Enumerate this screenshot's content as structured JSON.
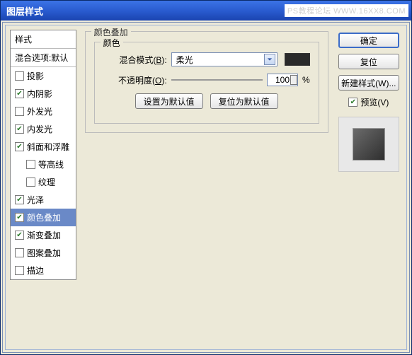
{
  "window": {
    "title": "图层样式"
  },
  "watermark": "PS教程论坛  WWW.16XX8.COM",
  "sidebar": {
    "header": "样式",
    "sub": "混合选项:默认",
    "items": [
      {
        "label": "投影",
        "checked": false,
        "indent": false,
        "selected": false
      },
      {
        "label": "内阴影",
        "checked": true,
        "indent": false,
        "selected": false
      },
      {
        "label": "外发光",
        "checked": false,
        "indent": false,
        "selected": false
      },
      {
        "label": "内发光",
        "checked": true,
        "indent": false,
        "selected": false
      },
      {
        "label": "斜面和浮雕",
        "checked": true,
        "indent": false,
        "selected": false
      },
      {
        "label": "等高线",
        "checked": false,
        "indent": true,
        "selected": false
      },
      {
        "label": "纹理",
        "checked": false,
        "indent": true,
        "selected": false
      },
      {
        "label": "光泽",
        "checked": true,
        "indent": false,
        "selected": false
      },
      {
        "label": "颜色叠加",
        "checked": true,
        "indent": false,
        "selected": true
      },
      {
        "label": "渐变叠加",
        "checked": true,
        "indent": false,
        "selected": false
      },
      {
        "label": "图案叠加",
        "checked": false,
        "indent": false,
        "selected": false
      },
      {
        "label": "描边",
        "checked": false,
        "indent": false,
        "selected": false
      }
    ]
  },
  "main": {
    "title": "颜色叠加",
    "subtitle": "颜色",
    "blend_label_prefix": "混合模式(",
    "blend_label_key": "B",
    "blend_label_suffix": "):",
    "blend_value": "柔光",
    "swatch_color": "#2a2a2a",
    "opacity_label_prefix": "不透明度(",
    "opacity_label_key": "O",
    "opacity_label_suffix": "):",
    "opacity_value": "100",
    "opacity_unit": "%",
    "btn_default": "设置为默认值",
    "btn_reset": "复位为默认值"
  },
  "right": {
    "ok": "确定",
    "reset": "复位",
    "newstyle": "新建样式(W)...",
    "preview_label": "预览(V)",
    "preview_checked": true
  }
}
